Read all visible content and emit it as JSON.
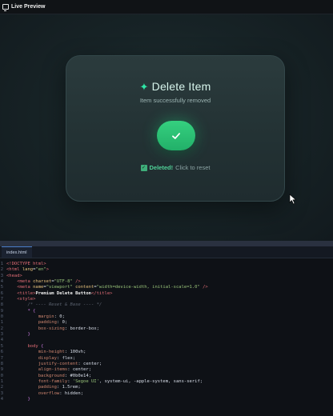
{
  "window": {
    "title": "Live Preview"
  },
  "card": {
    "sparkle": "✦",
    "title": "Delete Item",
    "subtitle": "Item successfully removed",
    "status_check": "✓",
    "status_bold": "Deleted!",
    "status_text": "Click to reset"
  },
  "editor": {
    "tab_label": "index.html"
  },
  "colors": {
    "accent": "#2ee6a6",
    "button": "#27b86e",
    "card": "#263638",
    "background": "#121a1e"
  }
}
